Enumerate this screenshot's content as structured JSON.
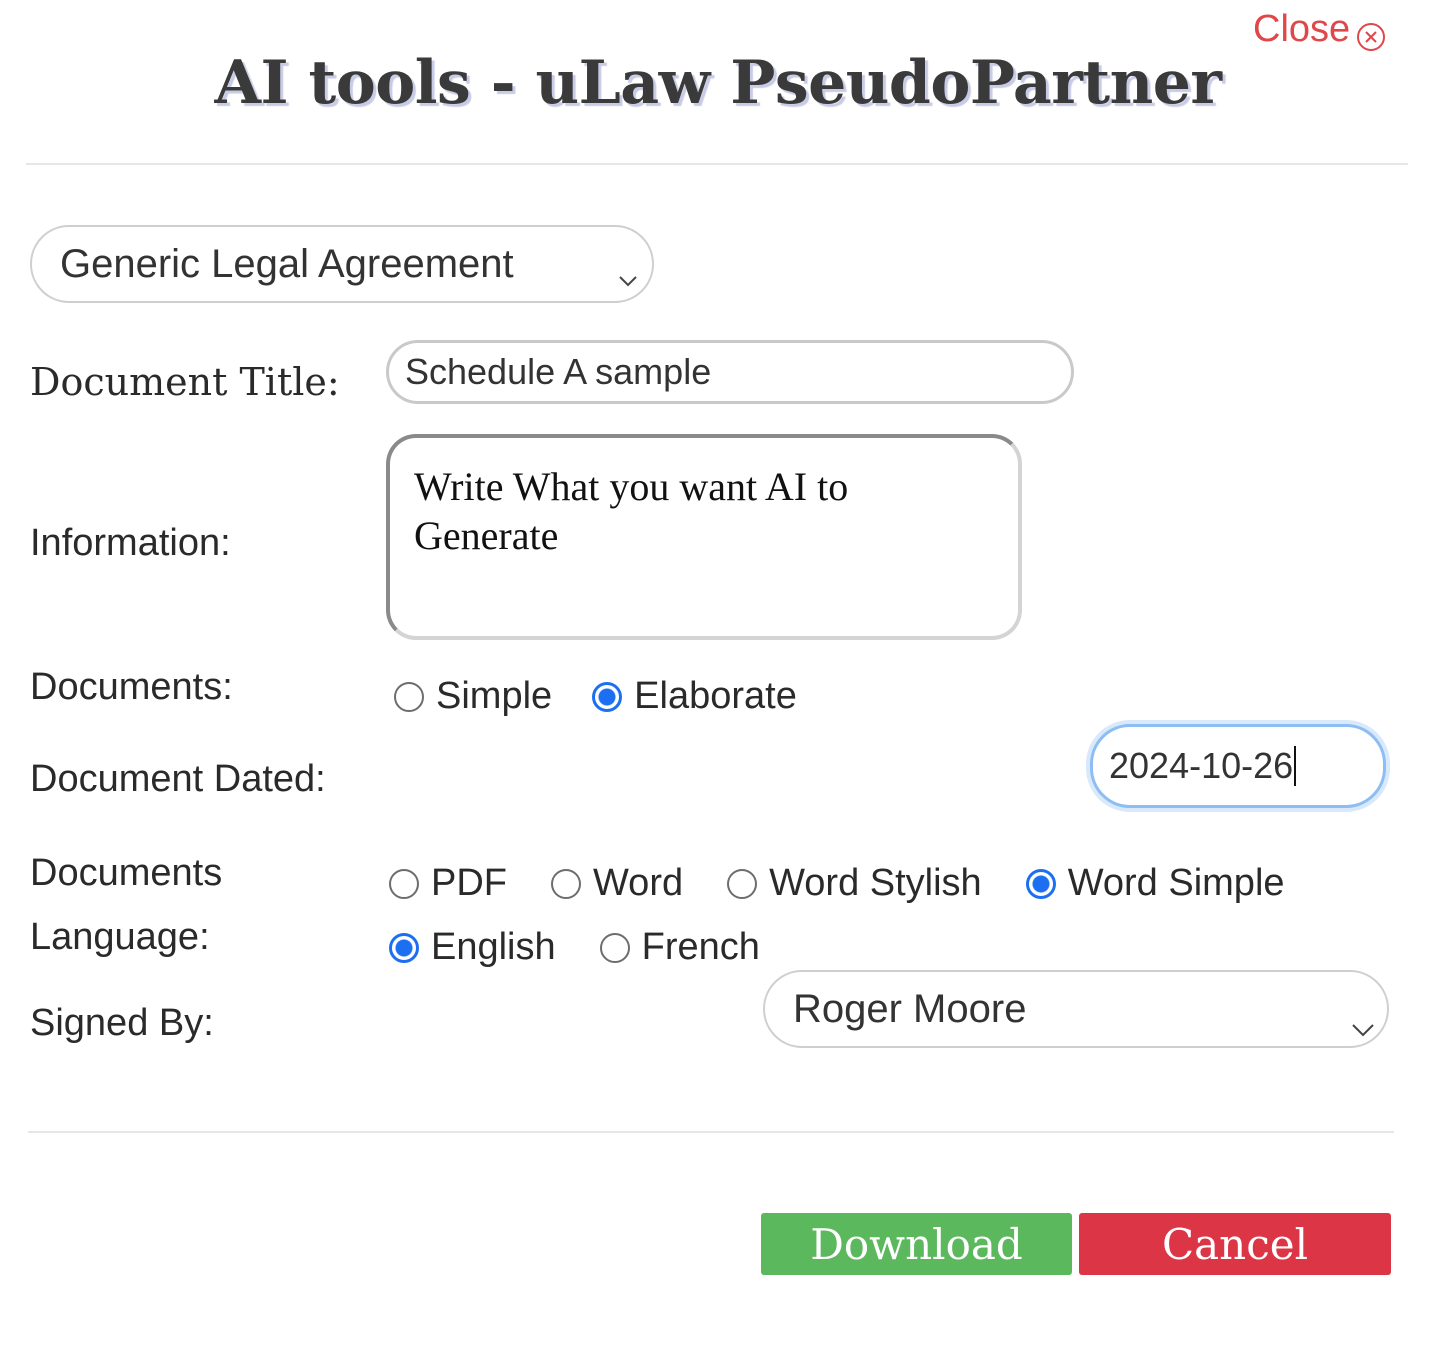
{
  "header": {
    "close_label": "Close",
    "title": "AI tools - uLaw PseudoPartner"
  },
  "form": {
    "template_select": {
      "value": "Generic Legal Agreement"
    },
    "document_title": {
      "label": "Document Title:",
      "value": "Schedule A sample"
    },
    "information": {
      "label": "Information:",
      "value": "Write What you want AI to Generate"
    },
    "documents": {
      "label": "Documents:",
      "options": [
        {
          "label": "Simple",
          "checked": false
        },
        {
          "label": "Elaborate",
          "checked": true
        }
      ]
    },
    "document_dated": {
      "label": "Document Dated:",
      "value": "2024-10-26"
    },
    "documents_format": {
      "label": "Documents",
      "options": [
        {
          "label": "PDF",
          "checked": false
        },
        {
          "label": "Word",
          "checked": false
        },
        {
          "label": "Word Stylish",
          "checked": false
        },
        {
          "label": "Word Simple",
          "checked": true
        }
      ]
    },
    "language": {
      "label": "Language:",
      "options": [
        {
          "label": "English",
          "checked": true
        },
        {
          "label": "French",
          "checked": false
        }
      ]
    },
    "signed_by": {
      "label": "Signed By:",
      "value": "Roger Moore"
    }
  },
  "actions": {
    "download_label": "Download",
    "cancel_label": "Cancel"
  },
  "colors": {
    "accent": "#1d6ff2",
    "download": "#5cb85c",
    "cancel": "#dc3545",
    "close": "#e0474b"
  }
}
